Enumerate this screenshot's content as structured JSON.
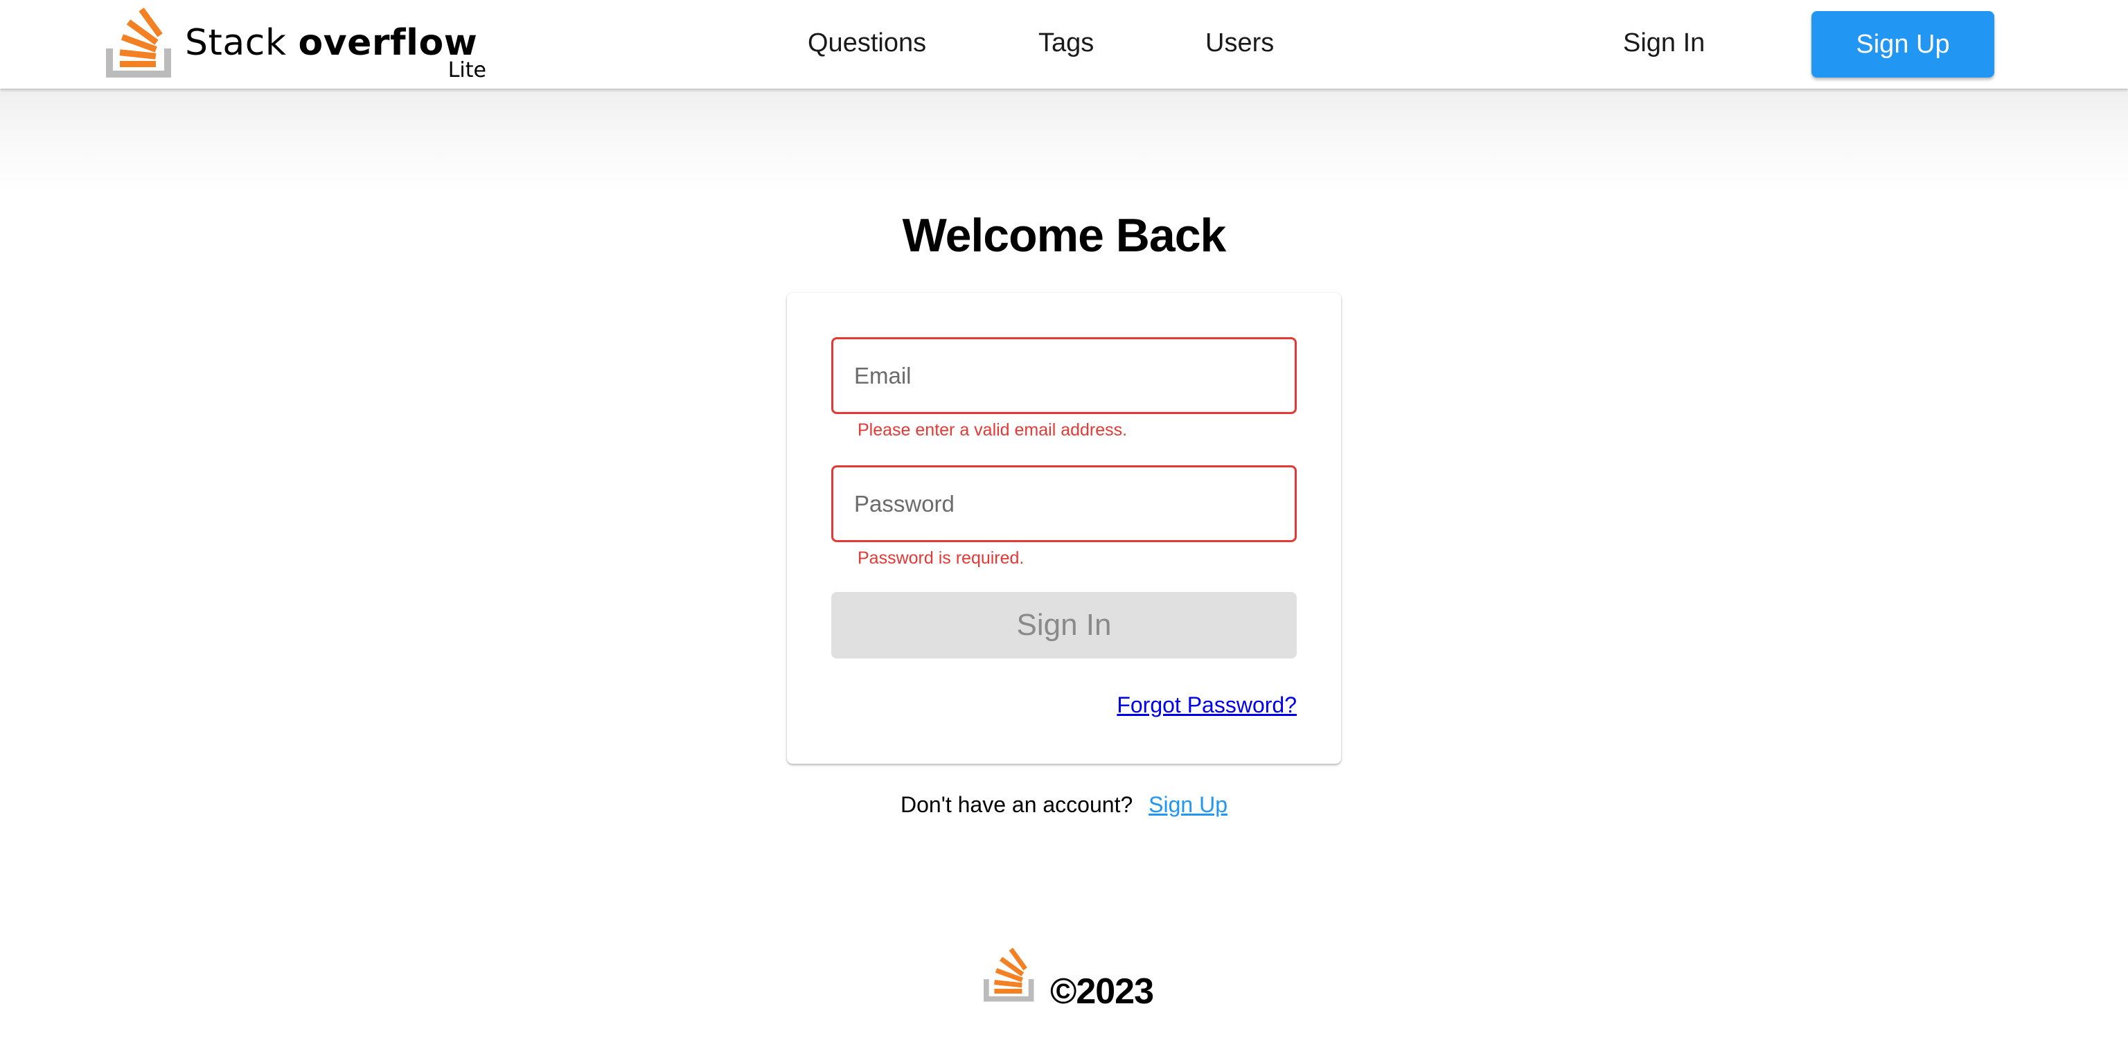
{
  "header": {
    "logo": {
      "icon": "stackoverflow-logo-icon",
      "text_light": "Stack",
      "text_bold": "overflow",
      "subtitle": "Lite"
    },
    "nav": {
      "questions": "Questions",
      "tags": "Tags",
      "users": "Users"
    },
    "sign_in_label": "Sign In",
    "sign_up_label": "Sign Up"
  },
  "main": {
    "title": "Welcome Back",
    "form": {
      "email": {
        "value": "",
        "placeholder": "Email",
        "error": "Please enter a valid email address."
      },
      "password": {
        "value": "",
        "placeholder": "Password",
        "error": "Password is required."
      },
      "submit_label": "Sign In",
      "submit_disabled": true,
      "forgot_password_label": "Forgot Password?"
    },
    "signup_prompt": "Don't have an account?",
    "signup_link_label": "Sign Up"
  },
  "footer": {
    "icon": "stackoverflow-logo-icon",
    "copyright": "©2023"
  },
  "colors": {
    "brand_orange": "#F48024",
    "tray_gray": "#BCBBBB",
    "primary_blue": "#2196F3",
    "error_red": "#E53935",
    "disabled_gray": "#E0E0E0",
    "link_blue": "#0000EE"
  }
}
